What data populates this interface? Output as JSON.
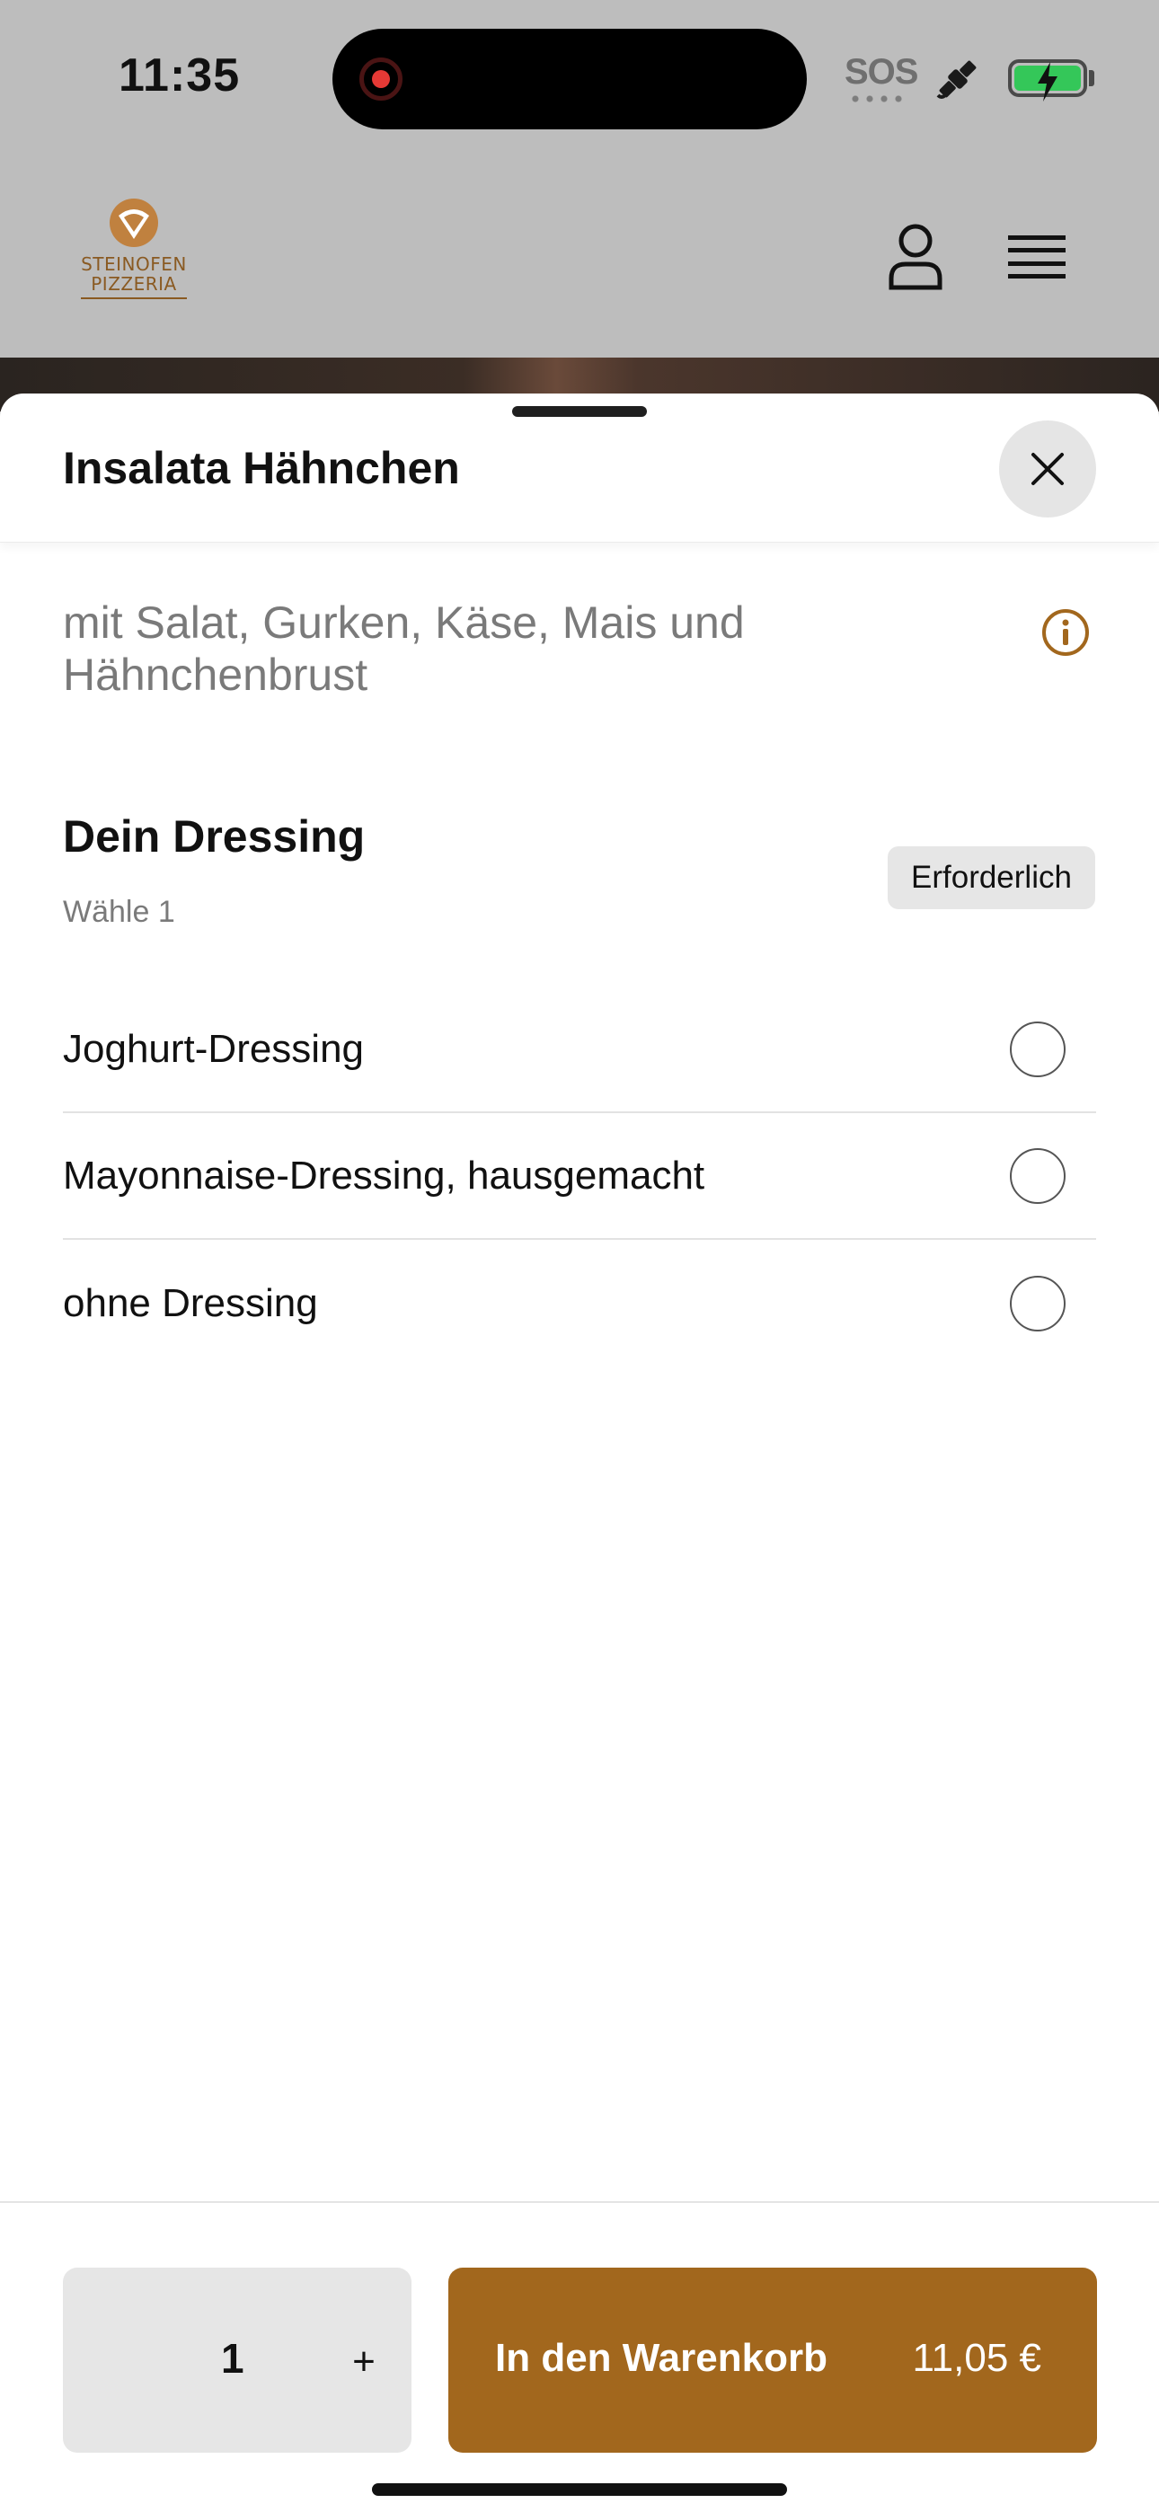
{
  "status_bar": {
    "time": "11:35",
    "sos": "SOS",
    "icons": [
      "recording-icon",
      "satellite-icon",
      "battery-charging-icon"
    ],
    "battery_color": "#34c759"
  },
  "header": {
    "logo_line1": "STEINOFEN",
    "logo_line2": "PIZZERIA",
    "brand_color": "#a2671d",
    "icons": [
      "user-icon",
      "menu-icon"
    ]
  },
  "sheet": {
    "title": "Insalata Hähnchen",
    "description": "mit Salat, Gurken, Käse, Mais und Hähnchenbrust",
    "group": {
      "title": "Dein Dressing",
      "subtitle": "Wähle 1",
      "badge": "Erforderlich",
      "options": [
        {
          "label": "Joghurt-Dressing",
          "selected": false
        },
        {
          "label": "Mayonnaise-Dressing, hausgemacht",
          "selected": false
        },
        {
          "label": "ohne Dressing",
          "selected": false
        }
      ]
    }
  },
  "footer": {
    "quantity": "1",
    "plus": "+",
    "add_label": "In den Warenkorb",
    "price": "11,05 €",
    "button_color": "#a2671d"
  }
}
